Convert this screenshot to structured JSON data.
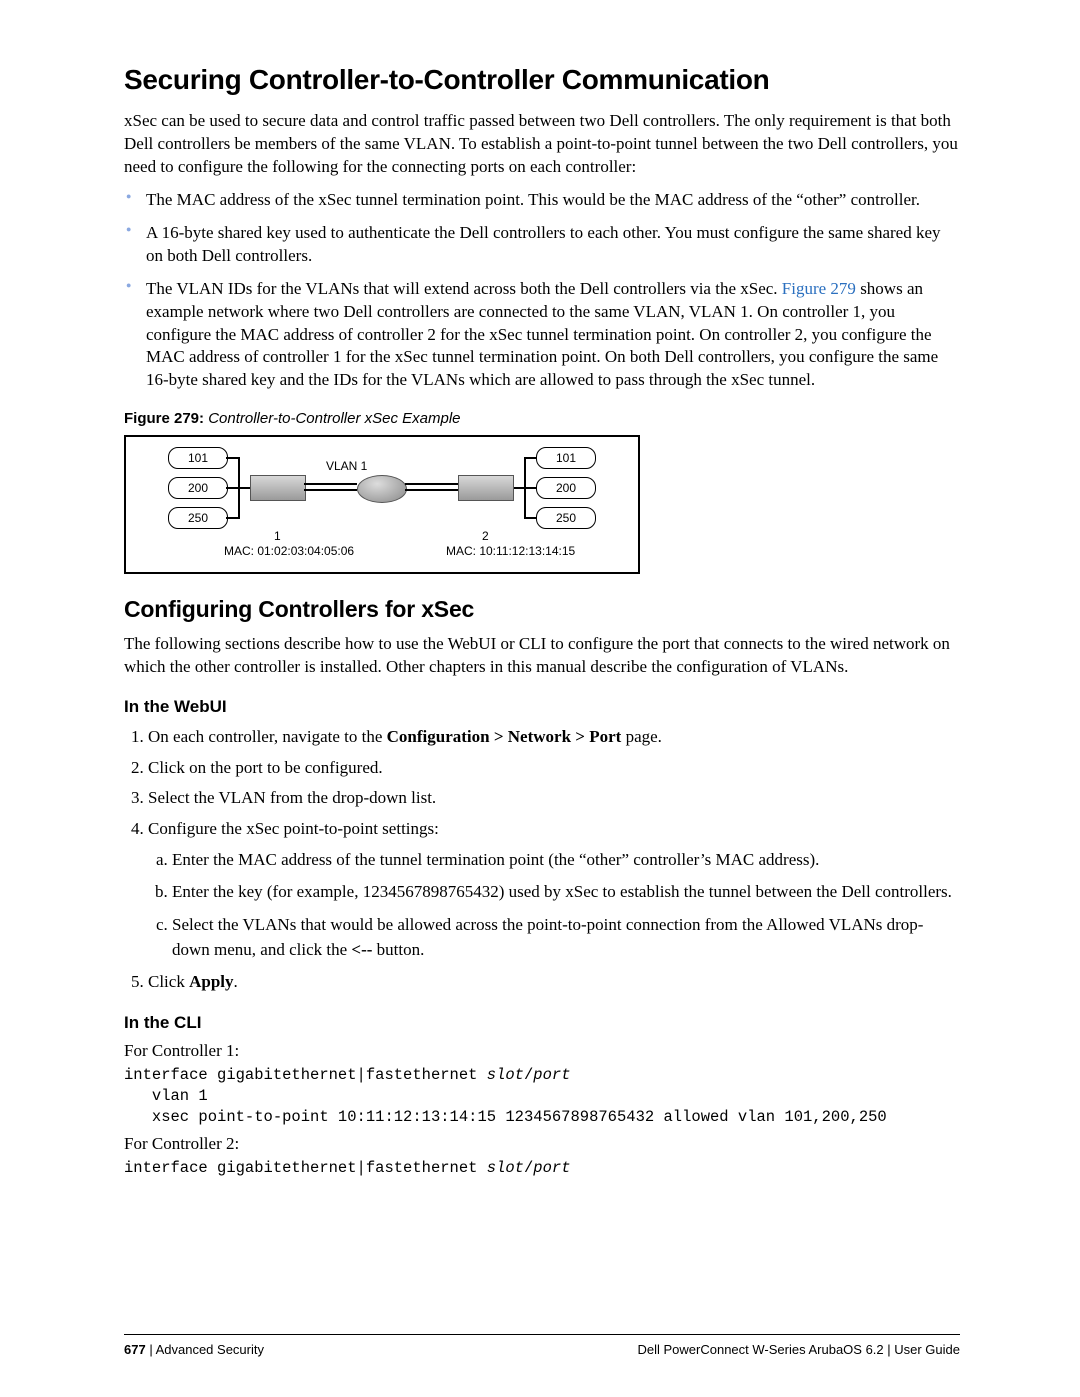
{
  "h1": "Securing Controller-to-Controller Communication",
  "intro": "xSec can be used to secure data and control traffic passed between two Dell controllers. The only requirement is that both Dell controllers be members of the same VLAN. To establish a point-to-point tunnel between the two Dell controllers, you need to configure the following for the connecting ports on each controller:",
  "bullets_pre_1": "The MAC address of the xSec tunnel termination point. This would be the MAC address of the “other” controller.",
  "bullets_pre_2": "A 16-byte shared key used to authenticate the Dell controllers to each other. You must configure the same shared key on both Dell controllers.",
  "bullets3_a": "The VLAN IDs for the VLANs that will extend across both the Dell controllers via the xSec. ",
  "bullets3_link": "Figure 279",
  "bullets3_b": " shows an example network where two Dell controllers are connected to the same VLAN, VLAN 1. On controller 1, you configure the MAC address of controller 2 for the xSec tunnel termination point. On controller 2, you configure the MAC address of controller 1 for the xSec tunnel termination point. On both Dell controllers, you configure the same 16-byte shared key and the IDs for the VLANs which are allowed to pass through the xSec tunnel.",
  "figcap_label": "Figure 279:",
  "figcap_title": " Controller-to-Controller xSec Example",
  "fig": {
    "chips_left": [
      "101",
      "200",
      "250"
    ],
    "chips_right": [
      "101",
      "200",
      "250"
    ],
    "vlan_label": "VLAN 1",
    "ctrl1_num": "1",
    "ctrl1_mac": "MAC: 01:02:03:04:05:06",
    "ctrl2_num": "2",
    "ctrl2_mac": "MAC: 10:11:12:13:14:15"
  },
  "h2": "Configuring Controllers for xSec",
  "config_intro": "The following sections describe how to use the WebUI or CLI to configure the port that connects to the wired network on which the other controller is installed. Other chapters in this manual describe the configuration of VLANs.",
  "h3_webui": "In the WebUI",
  "step1_a": "On each controller, navigate to the ",
  "step1_b": "Configuration > Network > Port",
  "step1_c": " page.",
  "step2": "Click on the port to be configured.",
  "step3": "Select the VLAN from the drop-down list.",
  "step4": "Configure the xSec point-to-point settings:",
  "step4a": "Enter the MAC address of the tunnel termination point (the “other” controller’s MAC address).",
  "step4b": "Enter the key (for example, 1234567898765432) used by xSec to establish the tunnel between the Dell controllers.",
  "step4c_a": "Select the VLANs that would be allowed across the point-to-point connection from the Allowed VLANs drop-down menu, and click the ",
  "step4c_b": "<--",
  "step4c_c": " button.",
  "step5_a": "Click ",
  "step5_b": "Apply",
  "step5_c": ".",
  "h3_cli": "In the CLI",
  "cli1_lead": "For Controller 1:",
  "cli1_line1_a": "interface gigabitethernet|fastethernet ",
  "cli1_line1_slot": "slot",
  "cli1_line1_slash": "/",
  "cli1_line1_port": "port",
  "cli1_line2": "   vlan 1",
  "cli1_line3": "   xsec point-to-point 10:11:12:13:14:15 1234567898765432 allowed vlan 101,200,250",
  "cli2_lead": "For Controller 2:",
  "cli2_line1_a": "interface gigabitethernet|fastethernet ",
  "cli2_line1_slot": "slot",
  "cli2_line1_slash": "/",
  "cli2_line1_port": "port",
  "footer_page": "677",
  "footer_section_sep": " | ",
  "footer_section": "Advanced Security",
  "footer_right": "Dell PowerConnect W-Series ArubaOS 6.2  |  User Guide"
}
